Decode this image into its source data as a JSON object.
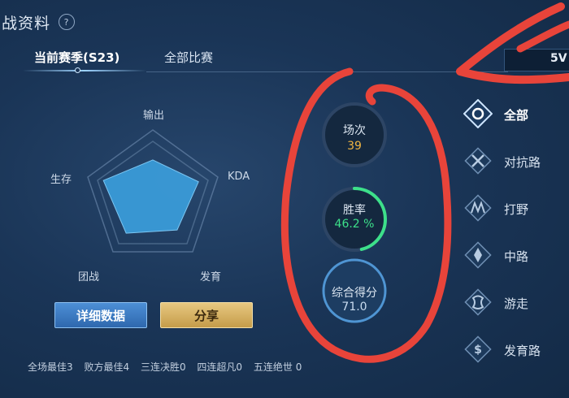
{
  "header": {
    "title": "战资料",
    "help_glyph": "?",
    "hero_tag": "5V"
  },
  "tabs": [
    {
      "label": "当前赛季(S23)",
      "active": true
    },
    {
      "label": "全部比赛",
      "active": false
    }
  ],
  "radar": {
    "labels": {
      "top": "输出",
      "right": "KDA",
      "bottom_right": "发育",
      "bottom_left": "团战",
      "left": "生存"
    },
    "values": [
      0.55,
      0.72,
      0.62,
      0.68,
      0.78
    ],
    "fill_color": "#3a9bd8"
  },
  "buttons": {
    "detail": "详细数据",
    "share": "分享"
  },
  "honors": [
    "全场最佳3",
    "败方最佳4",
    "三连决胜0",
    "四连超凡0",
    "五连绝世 0"
  ],
  "stats": {
    "matches": {
      "label": "场次",
      "value": "39",
      "color": "#f0b542"
    },
    "win_rate": {
      "label": "胜率",
      "value": "46.2 %",
      "fraction": 0.462,
      "color": "#3de08a"
    },
    "score": {
      "label": "综合得分",
      "value": "71.0",
      "color": "#c9dcf0"
    }
  },
  "roles": [
    {
      "label": "全部",
      "icon": "all-roles-icon",
      "active": true
    },
    {
      "label": "对抗路",
      "icon": "clash-lane-icon",
      "active": false
    },
    {
      "label": "打野",
      "icon": "jungle-icon",
      "active": false
    },
    {
      "label": "中路",
      "icon": "mid-lane-icon",
      "active": false
    },
    {
      "label": "游走",
      "icon": "roam-icon",
      "active": false
    },
    {
      "label": "发育路",
      "icon": "farm-lane-icon",
      "active": false
    }
  ],
  "annotation_color": "#e8443a"
}
